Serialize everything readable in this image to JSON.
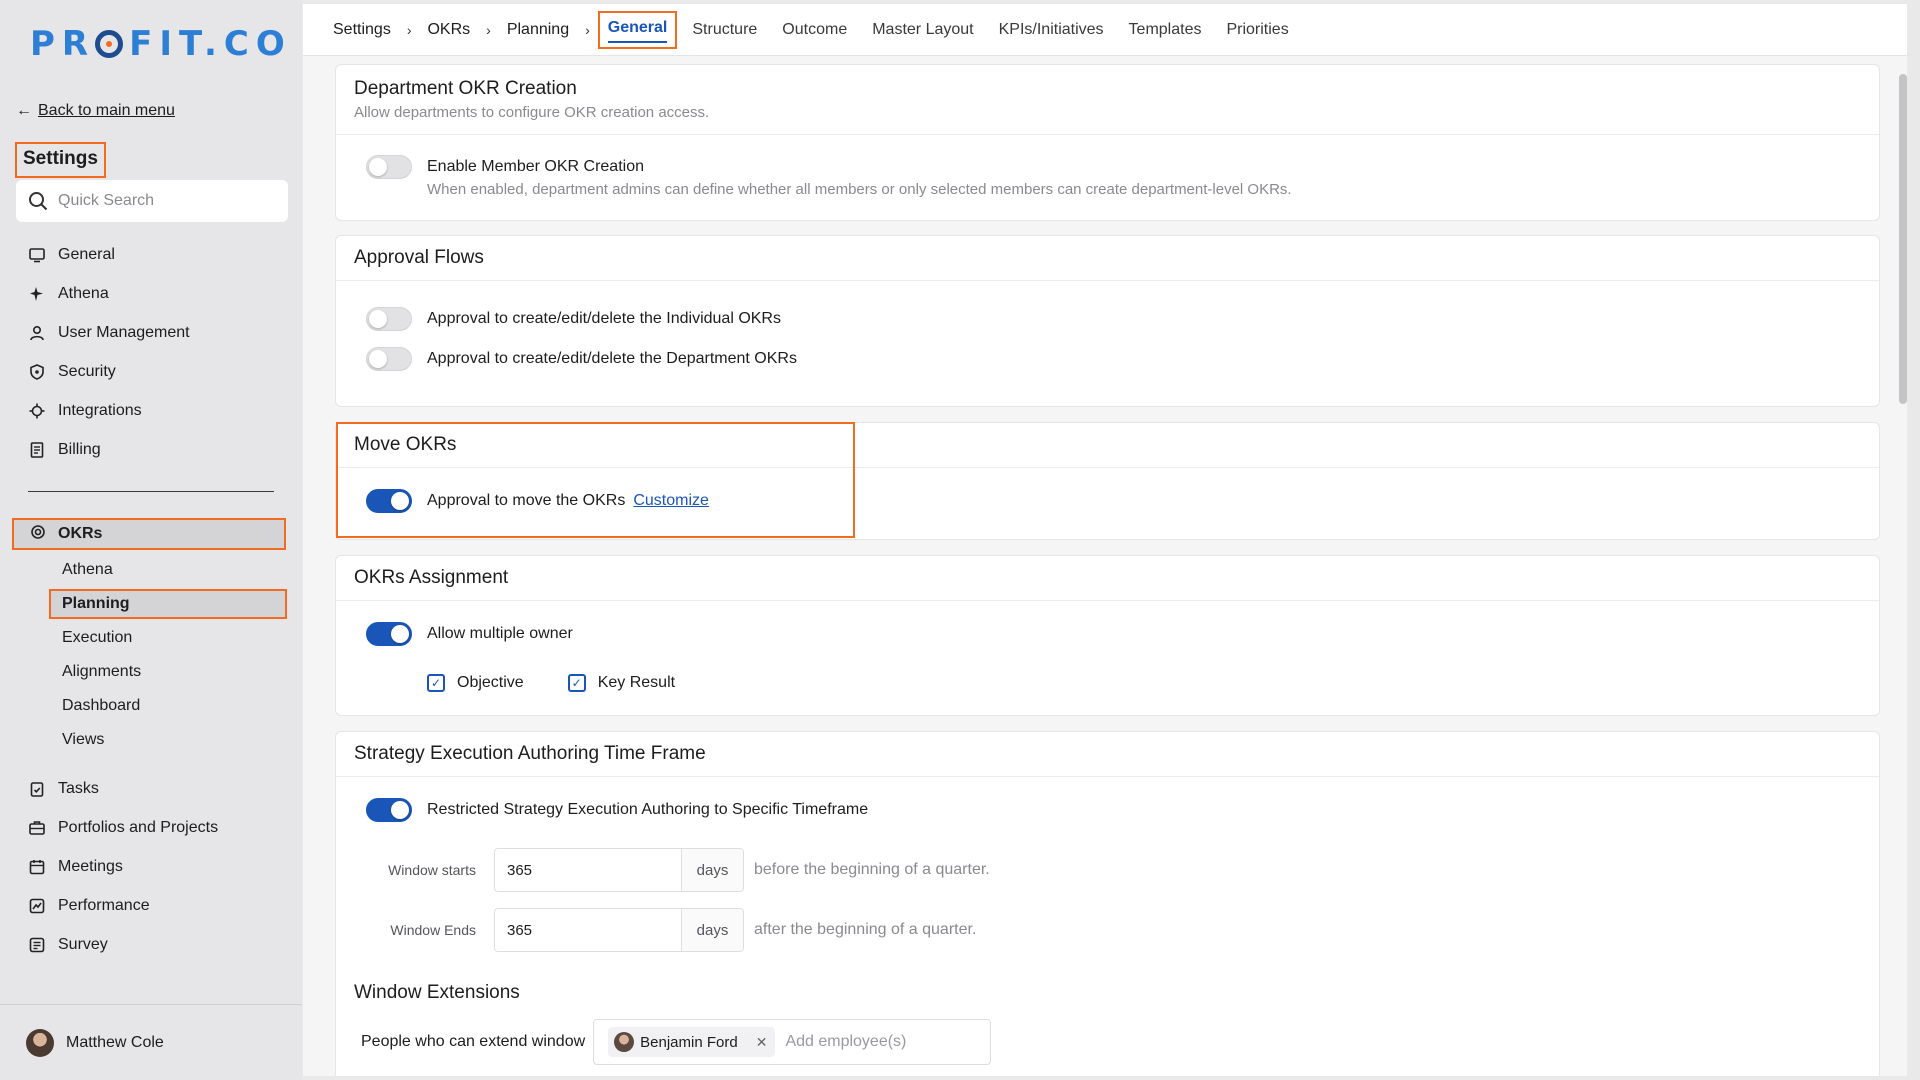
{
  "brand": {
    "logo_prefix": "PR",
    "logo_suffix": "FIT.CO",
    "logo_color": "#2d7fd6",
    "accent": "#f26b21"
  },
  "sidebar": {
    "back_label": "Back to main menu",
    "title": "Settings",
    "search_placeholder": "Quick Search",
    "items": [
      {
        "label": "General",
        "icon": "monitor-icon"
      },
      {
        "label": "Athena",
        "icon": "sparkle-icon"
      },
      {
        "label": "User Management",
        "icon": "user-icon"
      },
      {
        "label": "Security",
        "icon": "shield-icon"
      },
      {
        "label": "Integrations",
        "icon": "puzzle-icon"
      },
      {
        "label": "Billing",
        "icon": "receipt-icon"
      }
    ],
    "okrs_label": "OKRs",
    "okrs_sub": [
      "Athena",
      "Planning",
      "Execution",
      "Alignments",
      "Dashboard",
      "Views"
    ],
    "items_bottom": [
      {
        "label": "Tasks",
        "icon": "clipboard-icon"
      },
      {
        "label": "Portfolios and Projects",
        "icon": "briefcase-icon"
      },
      {
        "label": "Meetings",
        "icon": "calendar-icon"
      },
      {
        "label": "Performance",
        "icon": "chart-icon"
      },
      {
        "label": "Survey",
        "icon": "survey-icon"
      }
    ],
    "user_name": "Matthew Cole"
  },
  "breadcrumb": [
    "Settings",
    "OKRs",
    "Planning"
  ],
  "tabs": [
    "General",
    "Structure",
    "Outcome",
    "Master Layout",
    "KPIs/Initiatives",
    "Templates",
    "Priorities"
  ],
  "active_tab": "General",
  "dept_creation": {
    "title": "Department OKR Creation",
    "subtitle": "Allow departments to configure OKR creation access.",
    "toggle_label": "Enable Member OKR Creation",
    "toggle_desc": "When enabled, department admins can define whether all members or only selected members can create department-level OKRs.",
    "enabled": false
  },
  "approval_flows": {
    "title": "Approval Flows",
    "individual_label": "Approval to create/edit/delete the Individual OKRs",
    "individual_on": false,
    "department_label": "Approval to create/edit/delete the Department OKRs",
    "department_on": false
  },
  "move_okrs": {
    "title": "Move OKRs",
    "toggle_label": "Approval to move the OKRs",
    "customize_label": "Customize",
    "enabled": true
  },
  "assignment": {
    "title": "OKRs Assignment",
    "toggle_label": "Allow multiple owner",
    "enabled": true,
    "objective_label": "Objective",
    "objective_checked": true,
    "key_result_label": "Key Result",
    "key_result_checked": true
  },
  "timeframe": {
    "title": "Strategy Execution Authoring Time Frame",
    "toggle_label": "Restricted Strategy Execution Authoring to Specific Timeframe",
    "enabled": true,
    "window_starts_label": "Window starts",
    "window_starts_value": "365",
    "window_starts_unit": "days",
    "window_starts_after": "before the beginning of a quarter.",
    "window_ends_label": "Window Ends",
    "window_ends_value": "365",
    "window_ends_unit": "days",
    "window_ends_after": "after the beginning of a quarter.",
    "extensions_title": "Window Extensions",
    "people_label": "People who can extend window",
    "people_chip": "Benjamin Ford",
    "people_placeholder": "Add employee(s)"
  }
}
